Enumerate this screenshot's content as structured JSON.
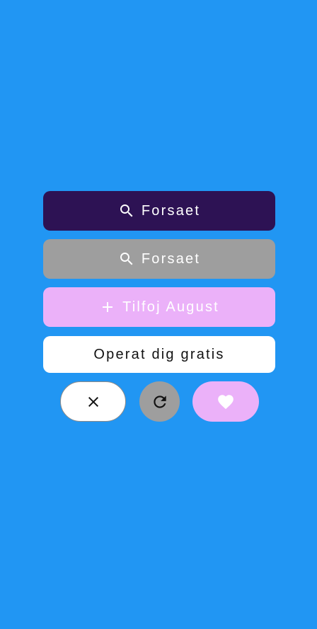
{
  "app": {
    "background_color": "#2196F3"
  },
  "buttons": {
    "primary": {
      "label": "Forsaet",
      "icon": "search-icon",
      "color": "#2D1254"
    },
    "disabled": {
      "label": "Forsaet",
      "icon": "search-icon",
      "color": "#9E9E9E"
    },
    "add": {
      "label": "Tilfoj August",
      "icon": "plus-icon",
      "color": "#EBB1F9"
    },
    "signup": {
      "label": "Operat dig gratis",
      "color": "#FFFFFF"
    }
  },
  "actions": {
    "close": {
      "icon": "close-icon"
    },
    "refresh": {
      "icon": "refresh-icon"
    },
    "favorite": {
      "icon": "heart-icon"
    }
  }
}
